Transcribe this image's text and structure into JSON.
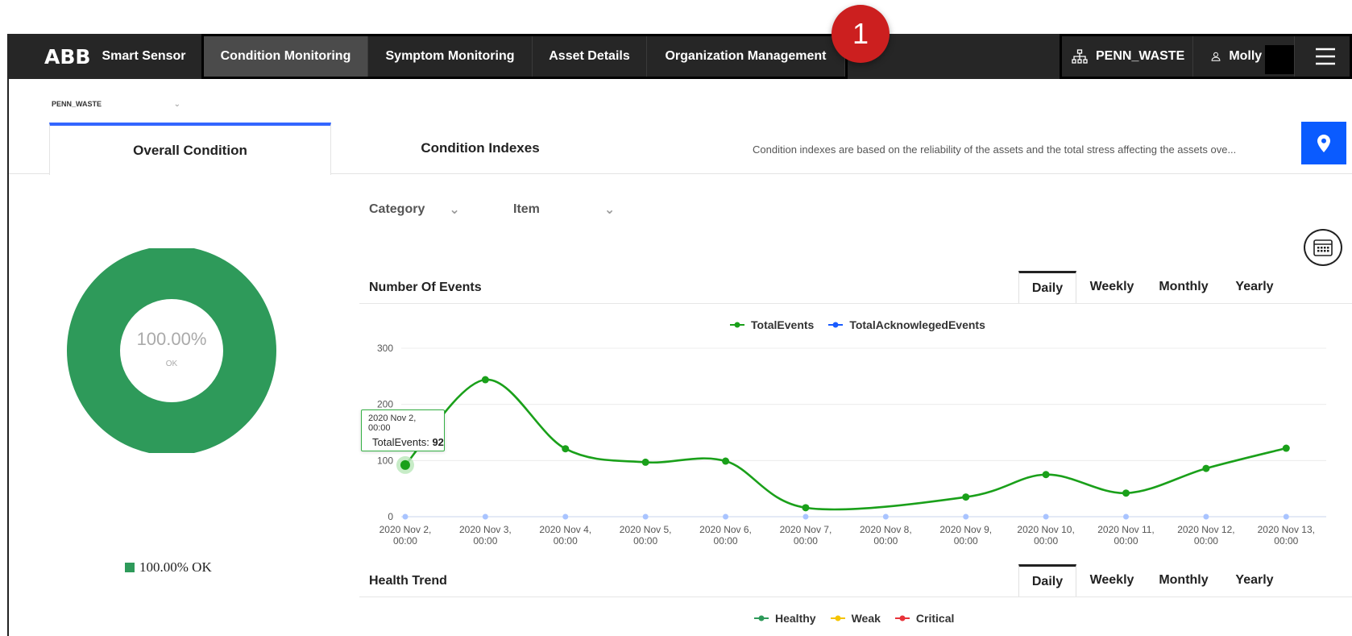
{
  "badge": "1",
  "header": {
    "logo": "ABB",
    "app_name": "Smart Sensor",
    "nav": [
      "Condition Monitoring",
      "Symptom Monitoring",
      "Asset Details",
      "Organization Management"
    ],
    "org": "PENN_WASTE",
    "user": "Molly"
  },
  "site_selector": "PENN_WASTE",
  "tabs": {
    "overall": "Overall Condition",
    "indexes": "Condition Indexes",
    "description": "Condition indexes are based on the reliability of the assets and the total stress affecting the assets ove..."
  },
  "overall": {
    "percent": "100.00%",
    "status": "OK",
    "legend": "100.00% OK",
    "color": "#2e9a5a"
  },
  "filters": {
    "category": "Category",
    "item": "Item"
  },
  "events": {
    "title": "Number Of Events",
    "periods": [
      "Daily",
      "Weekly",
      "Monthly",
      "Yearly"
    ],
    "active_period": "Daily",
    "tooltip": {
      "date": "2020 Nov 2, 00:00",
      "series": "TotalEvents",
      "value": "92"
    }
  },
  "health": {
    "title": "Health Trend",
    "periods": [
      "Daily",
      "Weekly",
      "Monthly",
      "Yearly"
    ],
    "legend": [
      {
        "name": "Healthy",
        "color": "#2e9a5a"
      },
      {
        "name": "Weak",
        "color": "#f5c400"
      },
      {
        "name": "Critical",
        "color": "#e8333a"
      }
    ]
  },
  "chart_data": {
    "type": "line",
    "title": "",
    "xlabel": "",
    "ylabel": "",
    "ylim": [
      0,
      300
    ],
    "yticks": [
      0,
      100,
      200,
      300
    ],
    "x": [
      "2020 Nov 2, 00:00",
      "2020 Nov 3, 00:00",
      "2020 Nov 4, 00:00",
      "2020 Nov 5, 00:00",
      "2020 Nov 6, 00:00",
      "2020 Nov 7, 00:00",
      "2020 Nov 8, 00:00",
      "2020 Nov 9, 00:00",
      "2020 Nov 10, 00:00",
      "2020 Nov 11, 00:00",
      "2020 Nov 12, 00:00",
      "2020 Nov 13, 00:00"
    ],
    "series": [
      {
        "name": "TotalEvents",
        "color": "#1aa01a",
        "values": [
          92,
          244,
          121,
          97,
          99,
          16,
          null,
          35,
          75,
          42,
          86,
          122
        ]
      },
      {
        "name": "TotalAcknowlegedEvents",
        "color": "#1a5cff",
        "values": [
          0,
          0,
          0,
          0,
          0,
          0,
          0,
          0,
          0,
          0,
          0,
          0
        ]
      }
    ],
    "grid": true,
    "legend": "top-center"
  }
}
